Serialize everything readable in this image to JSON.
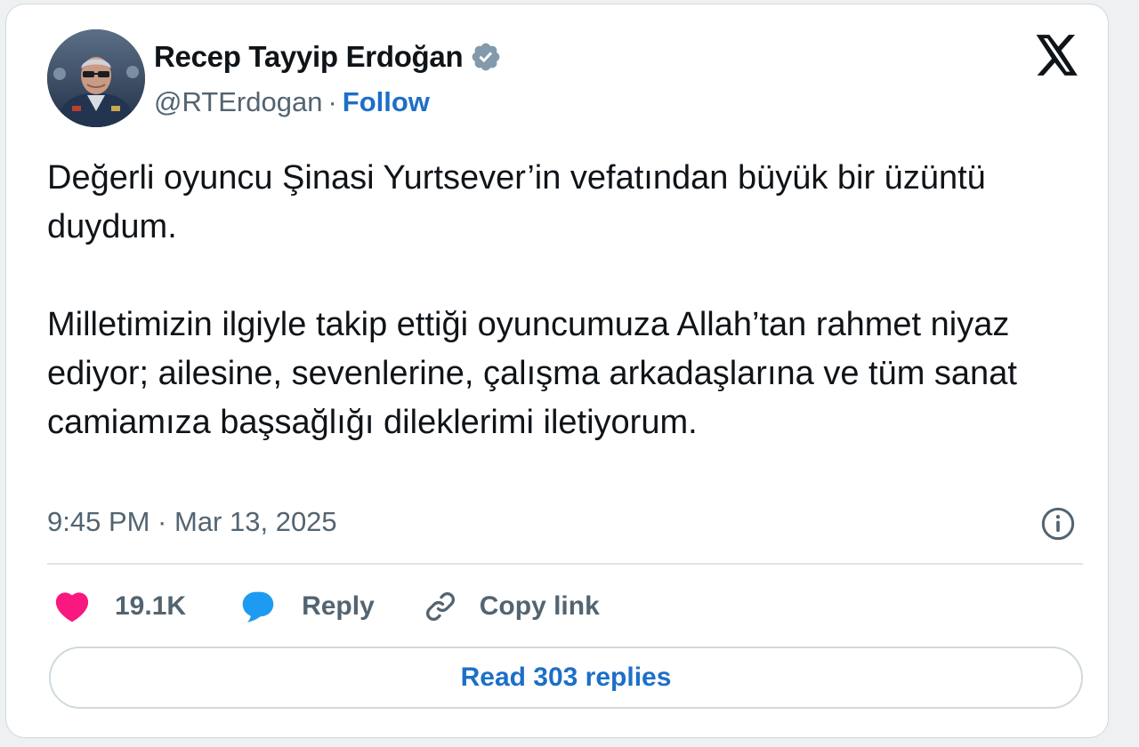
{
  "author": {
    "name": "Recep Tayyip Erdoğan",
    "handle": "@RTErdogan",
    "separator": "·",
    "follow_label": "Follow",
    "verified": true,
    "avatar_icon": "profile-photo"
  },
  "tweet": {
    "paragraphs": [
      "Değerli oyuncu Şinasi Yurtsever’in vefatından büyük bir üzüntü duydum.",
      "Milletimizin ilgiyle takip ettiği oyuncumuza Allah’tan rahmet niyaz ediyor; ailesine, sevenlerine, çalışma arkadaşlarına ve tüm sanat camiamıza başsağlığı dileklerimi iletiyorum."
    ],
    "timestamp": "9:45 PM · Mar 13, 2025"
  },
  "actions": {
    "like_count": "19.1K",
    "reply_label": "Reply",
    "copy_link_label": "Copy link"
  },
  "read_replies_label": "Read 303 replies",
  "icons": {
    "platform": "x-logo-icon",
    "verified": "verified-badge-icon",
    "info": "info-icon",
    "like": "heart-icon",
    "reply": "speech-bubble-icon",
    "copy": "link-icon"
  },
  "colors": {
    "link": "#1d6fc8",
    "like": "#f91880",
    "reply": "#1d9bf0",
    "muted": "#536471",
    "text": "#0f1419",
    "verified_badge": "#829aab"
  }
}
